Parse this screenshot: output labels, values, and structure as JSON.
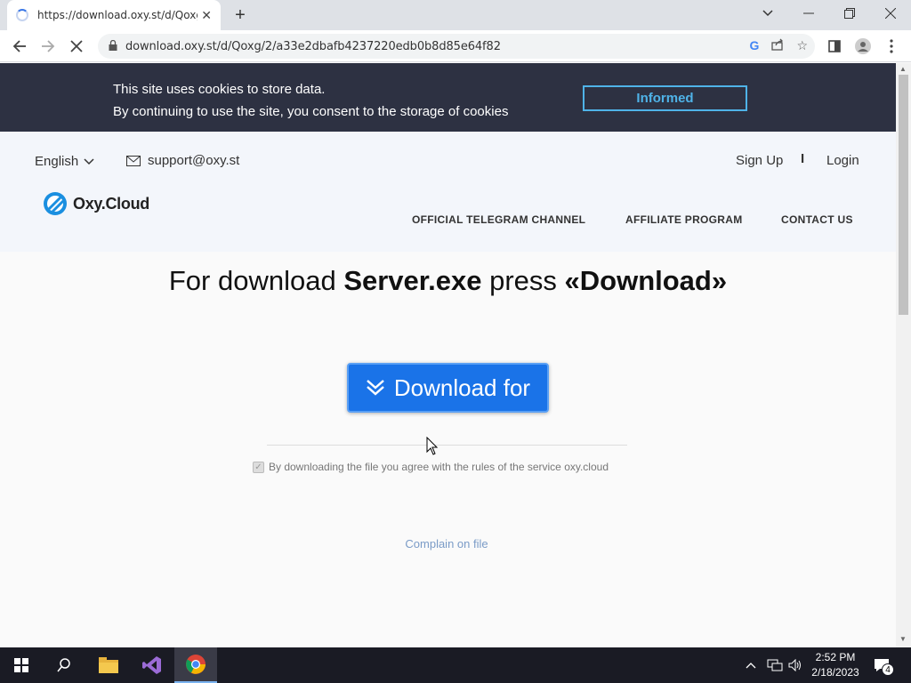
{
  "browser": {
    "tab_title": "https://download.oxy.st/d/Qoxg/",
    "url": "download.oxy.st/d/Qoxg/2/a33e2dbafb4237220edb0b8d85e64f82"
  },
  "cookie": {
    "line1": "This site uses cookies to store data.",
    "line2": "By continuing to use the site, you consent to the storage of cookies",
    "button": "Informed"
  },
  "header": {
    "language": "English",
    "email": "support@oxy.st",
    "signup": "Sign Up",
    "separator": "I",
    "login": "Login",
    "logo": "Oxy.Cloud",
    "nav": [
      "OFFICIAL TELEGRAM CHANNEL",
      "AFFILIATE PROGRAM",
      "CONTACT US"
    ]
  },
  "main": {
    "headline_prefix": "For download ",
    "filename": "Server.exe",
    "headline_mid": " press ",
    "headline_action": "«Download»",
    "download_button": "Download for",
    "agree_text": "By downloading the file you agree with the rules of the service oxy.cloud",
    "complain": "Complain on file"
  },
  "taskbar": {
    "time": "2:52 PM",
    "date": "2/18/2023",
    "notifications": "4"
  },
  "colors": {
    "accent": "#1a73e8",
    "banner": "#2d3142",
    "banner_button": "#4fb3e8"
  }
}
